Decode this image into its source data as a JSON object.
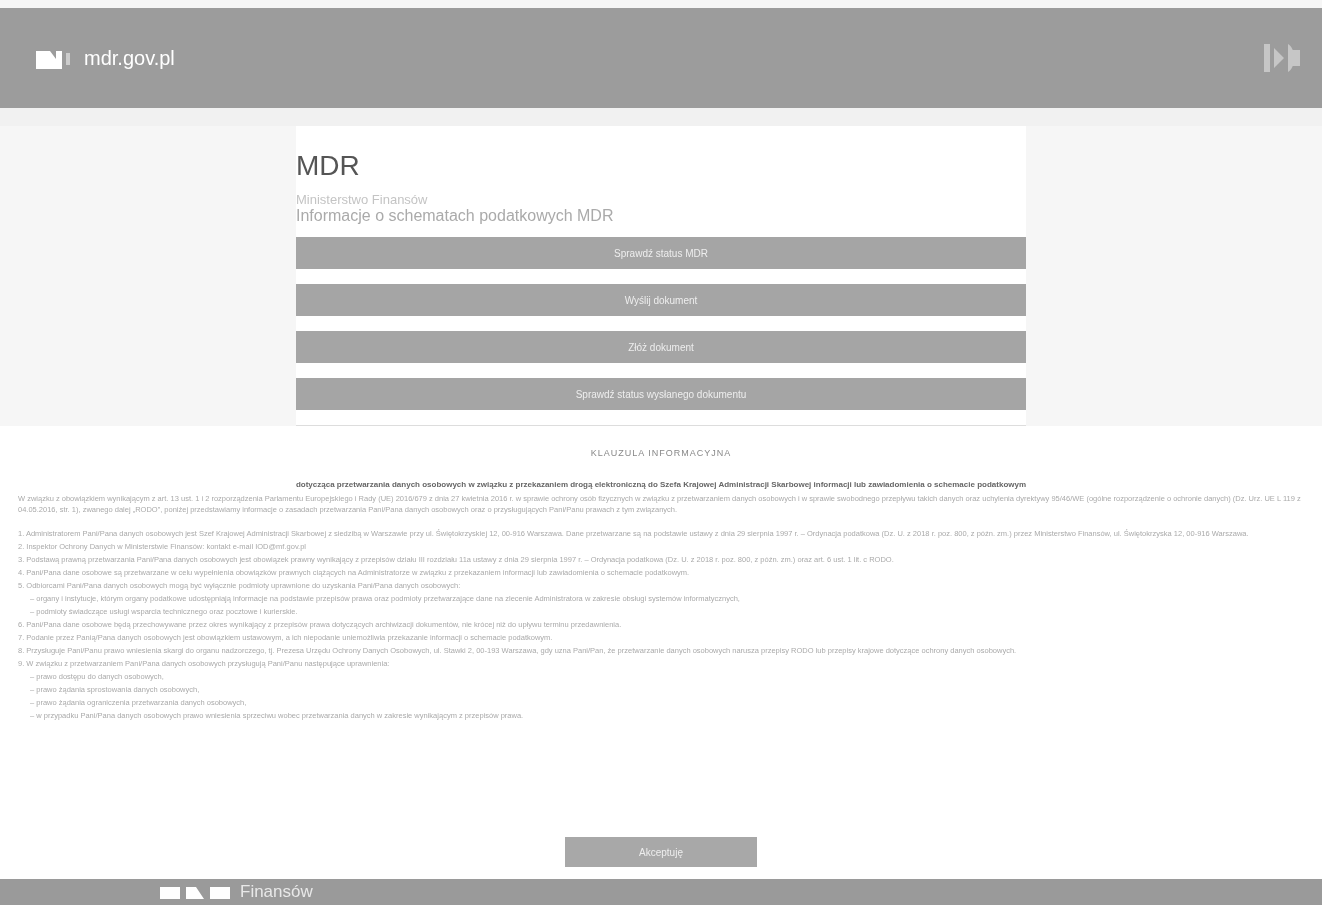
{
  "header": {
    "site": "mdr.gov.pl"
  },
  "main": {
    "title": "MDR",
    "ministry": "Ministerstwo Finansów",
    "subtitle": "Informacje o schematach podatkowych MDR",
    "buttons": [
      "Sprawdź status MDR",
      "Wyślij dokument",
      "Złóż dokument",
      "Sprawdź status wysłanego dokumentu"
    ]
  },
  "clause": {
    "heading": "KLAUZULA INFORMACYJNA",
    "title": "dotycząca przetwarzania danych osobowych w związku z przekazaniem drogą elektroniczną do Szefa Krajowej Administracji Skarbowej informacji lub zawiadomienia o schemacie podatkowym",
    "intro": "W związku z obowiązkiem wynikającym z art. 13 ust. 1 i 2 rozporządzenia Parlamentu Europejskiego i Rady (UE) 2016/679 z dnia 27 kwietnia 2016 r. w sprawie ochrony osób fizycznych w związku z przetwarzaniem danych osobowych i w sprawie swobodnego przepływu takich danych oraz uchylenia dyrektywy 95/46/WE (ogólne rozporządzenie o ochronie danych) (Dz. Urz. UE L 119 z 04.05.2016, str. 1), zwanego dalej „RODO”, poniżej przedstawiamy informacje o zasadach przetwarzania Pani/Pana danych osobowych oraz o przysługujących Pani/Panu prawach z tym związanych.",
    "items": [
      {
        "text": "1. Administratorem Pani/Pana danych osobowych jest Szef Krajowej Administracji Skarbowej z siedzibą w Warszawie przy ul. Świętokrzyskiej 12, 00-916 Warszawa. Dane przetwarzane są na podstawie ustawy z dnia 29 sierpnia 1997 r. – Ordynacja podatkowa (Dz. U. z 2018 r. poz. 800, z późn. zm.) przez Ministerstwo Finansów, ul. Świętokrzyska 12, 00-916 Warszawa."
      },
      {
        "text": "2. Inspektor Ochrony Danych w Ministerstwie Finansów: kontakt e-mail IOD@mf.gov.pl"
      },
      {
        "text": "3. Podstawą prawną przetwarzania Pani/Pana danych osobowych jest obowiązek prawny wynikający z przepisów działu III rozdziału 11a ustawy z dnia 29 sierpnia 1997 r. – Ordynacja podatkowa (Dz. U. z 2018 r. poz. 800, z późn. zm.) oraz art. 6 ust. 1 lit. c RODO."
      },
      {
        "text": "4. Pani/Pana dane osobowe są przetwarzane w celu wypełnienia obowiązków prawnych ciążących na Administratorze w związku z przekazaniem informacji lub zawiadomienia o schemacie podatkowym."
      },
      {
        "text": "5. Odbiorcami Pani/Pana danych osobowych mogą być wyłącznie podmioty uprawnione do uzyskania Pani/Pana danych osobowych:",
        "children": [
          {
            "text": "– organy i instytucje, którym organy podatkowe udostępniają informacje na podstawie przepisów prawa oraz podmioty przetwarzające dane na zlecenie Administratora w zakresie obsługi systemów informatycznych,"
          },
          {
            "text": "– podmioty świadczące usługi wsparcia technicznego oraz pocztowe i kurierskie."
          }
        ]
      },
      {
        "text": "6. Pani/Pana dane osobowe będą przechowywane przez okres wynikający z przepisów prawa dotyczących archiwizacji dokumentów, nie krócej niż do upływu terminu przedawnienia."
      },
      {
        "text": "7. Podanie przez Panią/Pana danych osobowych jest obowiązkiem ustawowym, a ich niepodanie uniemożliwia przekazanie informacji o schemacie podatkowym."
      },
      {
        "text": "8. Przysługuje Pani/Panu prawo wniesienia skargi do organu nadzorczego, tj. Prezesa Urzędu Ochrony Danych Osobowych, ul. Stawki 2, 00-193 Warszawa, gdy uzna Pani/Pan, że przetwarzanie danych osobowych narusza przepisy RODO lub przepisy krajowe dotyczące ochrony danych osobowych."
      },
      {
        "text": "9. W związku z przetwarzaniem Pani/Pana danych osobowych przysługują Pani/Panu następujące uprawnienia:",
        "children": [
          {
            "text": "– prawo dostępu do danych osobowych,"
          },
          {
            "text": "– prawo żądania sprostowania danych osobowych,"
          },
          {
            "text": "– prawo żądania ograniczenia przetwarzania danych osobowych,"
          },
          {
            "text": "– w przypadku Pani/Pana danych osobowych prawo wniesienia sprzeciwu wobec przetwarzania danych w zakresie wynikającym z przepisów prawa."
          }
        ]
      }
    ],
    "accept": "Akceptuję"
  },
  "footer": {
    "text": "Finansów"
  }
}
